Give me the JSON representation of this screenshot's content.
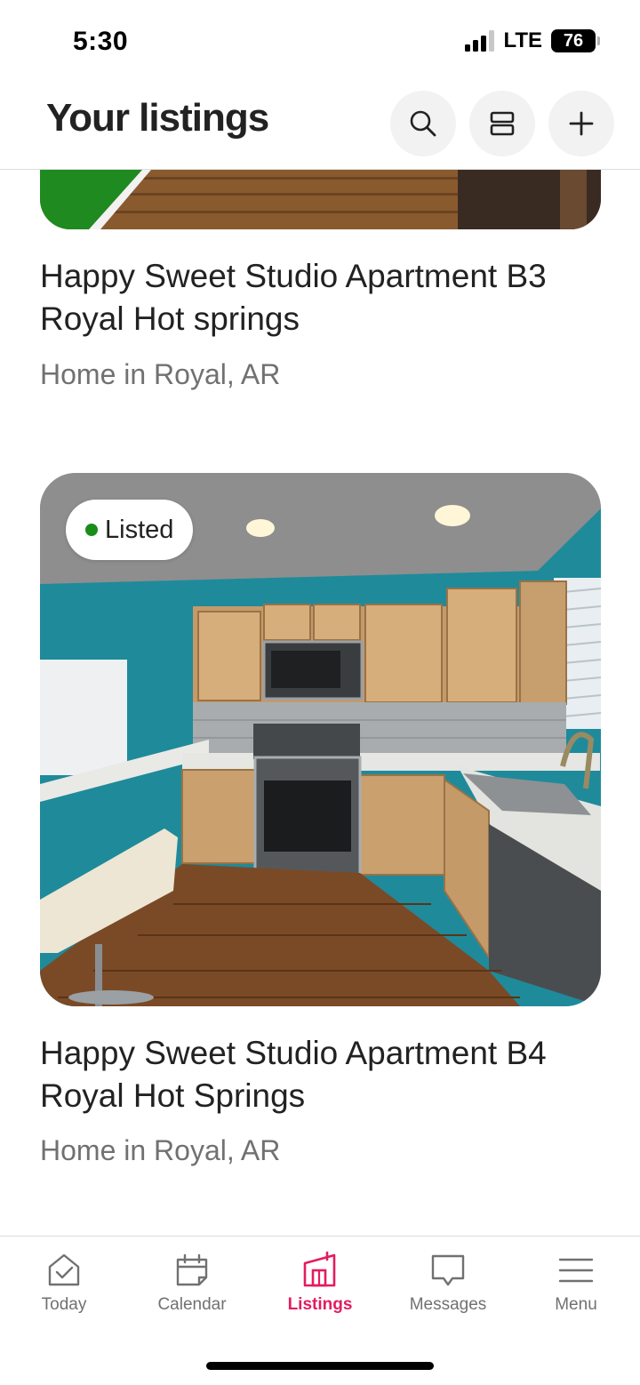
{
  "status_bar": {
    "time": "5:30",
    "network": "LTE",
    "battery": "76"
  },
  "header": {
    "title": "Your listings"
  },
  "listings": [
    {
      "title": "Happy Sweet Studio Apartment B3 Royal Hot springs",
      "subtitle": "Home in Royal, AR"
    },
    {
      "title": "Happy Sweet Studio Apartment B4 Royal Hot Springs",
      "subtitle": "Home in Royal, AR",
      "badge": "Listed"
    }
  ],
  "tabs": [
    {
      "label": "Today",
      "icon": "today-icon"
    },
    {
      "label": "Calendar",
      "icon": "calendar-icon"
    },
    {
      "label": "Listings",
      "icon": "listings-icon",
      "active": true
    },
    {
      "label": "Messages",
      "icon": "messages-icon"
    },
    {
      "label": "Menu",
      "icon": "menu-icon"
    }
  ],
  "colors": {
    "accent": "#e31c5f",
    "listed_dot": "#1a8c1a",
    "text": "#222222",
    "muted": "#717171"
  }
}
